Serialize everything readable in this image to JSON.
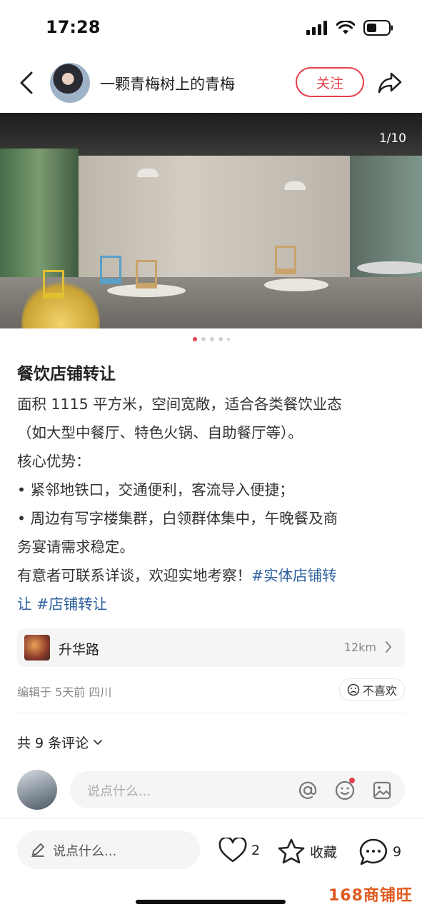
{
  "status_bar": {
    "time": "17:28"
  },
  "header": {
    "author_name": "一颗青梅树上的青梅",
    "follow_label": "关注"
  },
  "gallery": {
    "counter": "1/10",
    "total_dots": 5,
    "active_dot": 1
  },
  "post": {
    "title": "餐饮店铺转让",
    "lines": [
      "面积 1115 平方米，空间宽敞，适合各类餐饮业态",
      "（如大型中餐厅、特色火锅、自助餐厅等）。",
      "核心优势：",
      "• 紧邻地铁口，交通便利，客流导入便捷；",
      "• 周边有写字楼集群，白领群体集中，午晚餐及商",
      "务宴请需求稳定。"
    ],
    "last_line_text": "有意者可联系详谈，欢迎实地考察！",
    "tag1_part1": "#实体店铺转",
    "tag1_part2": "让",
    "tag2": "#店铺转让"
  },
  "location": {
    "name": "升华路",
    "distance": "12km"
  },
  "meta": {
    "edited": "编辑于 5天前 四川",
    "dislike_label": "不喜欢"
  },
  "comments": {
    "count_label": "共 9 条评论",
    "input_placeholder": "说点什么..."
  },
  "bottom_bar": {
    "input_placeholder": "说点什么...",
    "likes": "2",
    "collect_label": "收藏",
    "comments": "9"
  },
  "watermark": "168商铺旺",
  "colors": {
    "accent": "#e8404a",
    "tag": "#2c5f9e",
    "watermark": "#e05a20"
  }
}
